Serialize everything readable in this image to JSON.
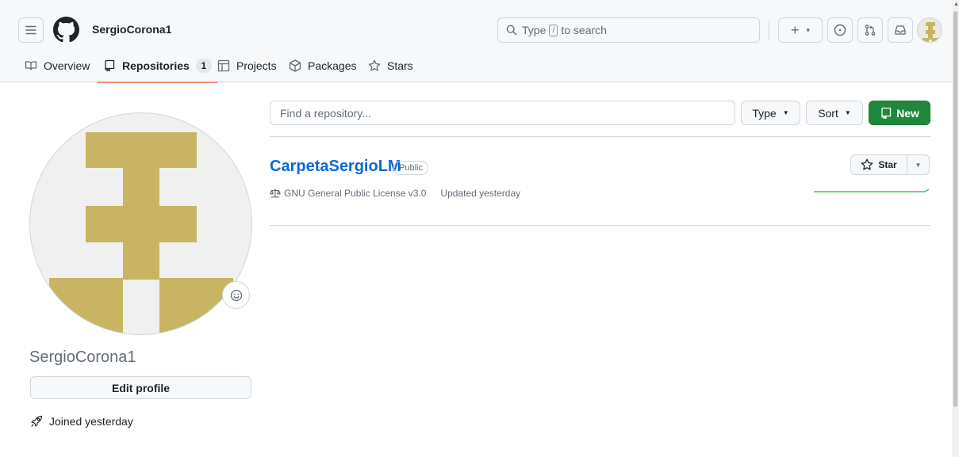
{
  "header": {
    "username": "SergioCorona1",
    "search": {
      "prefix": "Type",
      "key": "/",
      "suffix": "to search"
    },
    "buttons": {
      "plus": "+",
      "caret": "▾"
    }
  },
  "nav": {
    "tabs": [
      {
        "label": "Overview",
        "icon": "book-icon"
      },
      {
        "label": "Repositories",
        "icon": "repo-icon",
        "count": "1",
        "active": true
      },
      {
        "label": "Projects",
        "icon": "table-icon"
      },
      {
        "label": "Packages",
        "icon": "package-icon"
      },
      {
        "label": "Stars",
        "icon": "star-icon"
      }
    ],
    "active_color": "#fd8c73"
  },
  "profile": {
    "name": "SergioCorona1",
    "edit_label": "Edit profile",
    "joined": "Joined yesterday",
    "avatar_color": "#c8b463"
  },
  "repos": {
    "find_placeholder": "Find a repository...",
    "type_label": "Type",
    "sort_label": "Sort",
    "new_label": "New",
    "new_color": "#1f883d",
    "items": [
      {
        "name": "CarpetaSergioLM",
        "visibility": "Public",
        "license": "GNU General Public License v3.0",
        "updated": "Updated yesterday",
        "star_label": "Star"
      }
    ]
  }
}
